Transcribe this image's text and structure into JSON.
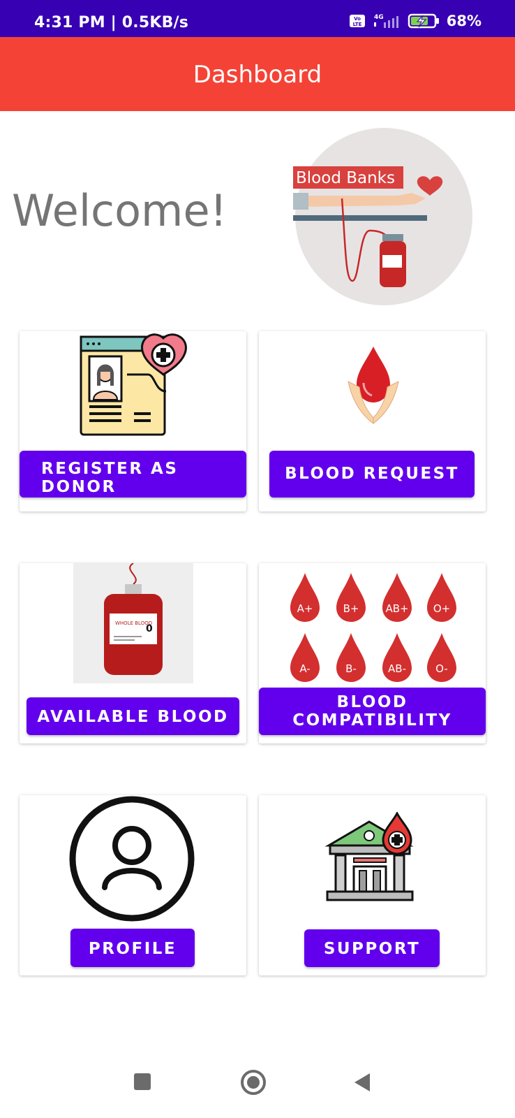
{
  "status_bar": {
    "time": "4:31 PM | 0.5KB/s",
    "network": "4G",
    "volte": "Vo LTE",
    "battery": "68%"
  },
  "app_bar": {
    "title": "Dashboard"
  },
  "welcome": {
    "text": "Welcome!",
    "banner_label": "Blood Banks"
  },
  "cards": {
    "register": {
      "label": "REGISTER AS DONOR"
    },
    "request": {
      "label": "BLOOD REQUEST"
    },
    "available": {
      "label": "AVAILABLE BLOOD",
      "bag_label": "WHOLE BLOOD",
      "bag_group": "0"
    },
    "compatibility": {
      "label": "BLOOD COMPATIBILITY",
      "groups": [
        "A+",
        "B+",
        "AB+",
        "O+",
        "A-",
        "B-",
        "AB-",
        "O-"
      ]
    },
    "profile": {
      "label": "PROFILE"
    },
    "support": {
      "label": "SUPPORT"
    }
  },
  "colors": {
    "status_bar": "#3700b3",
    "app_bar": "#f44336",
    "button": "#6200ee",
    "blood": "#d32f2f"
  },
  "icons": {
    "nav_recent": "square-icon",
    "nav_home": "circle-home-icon",
    "nav_back": "triangle-back-icon"
  }
}
